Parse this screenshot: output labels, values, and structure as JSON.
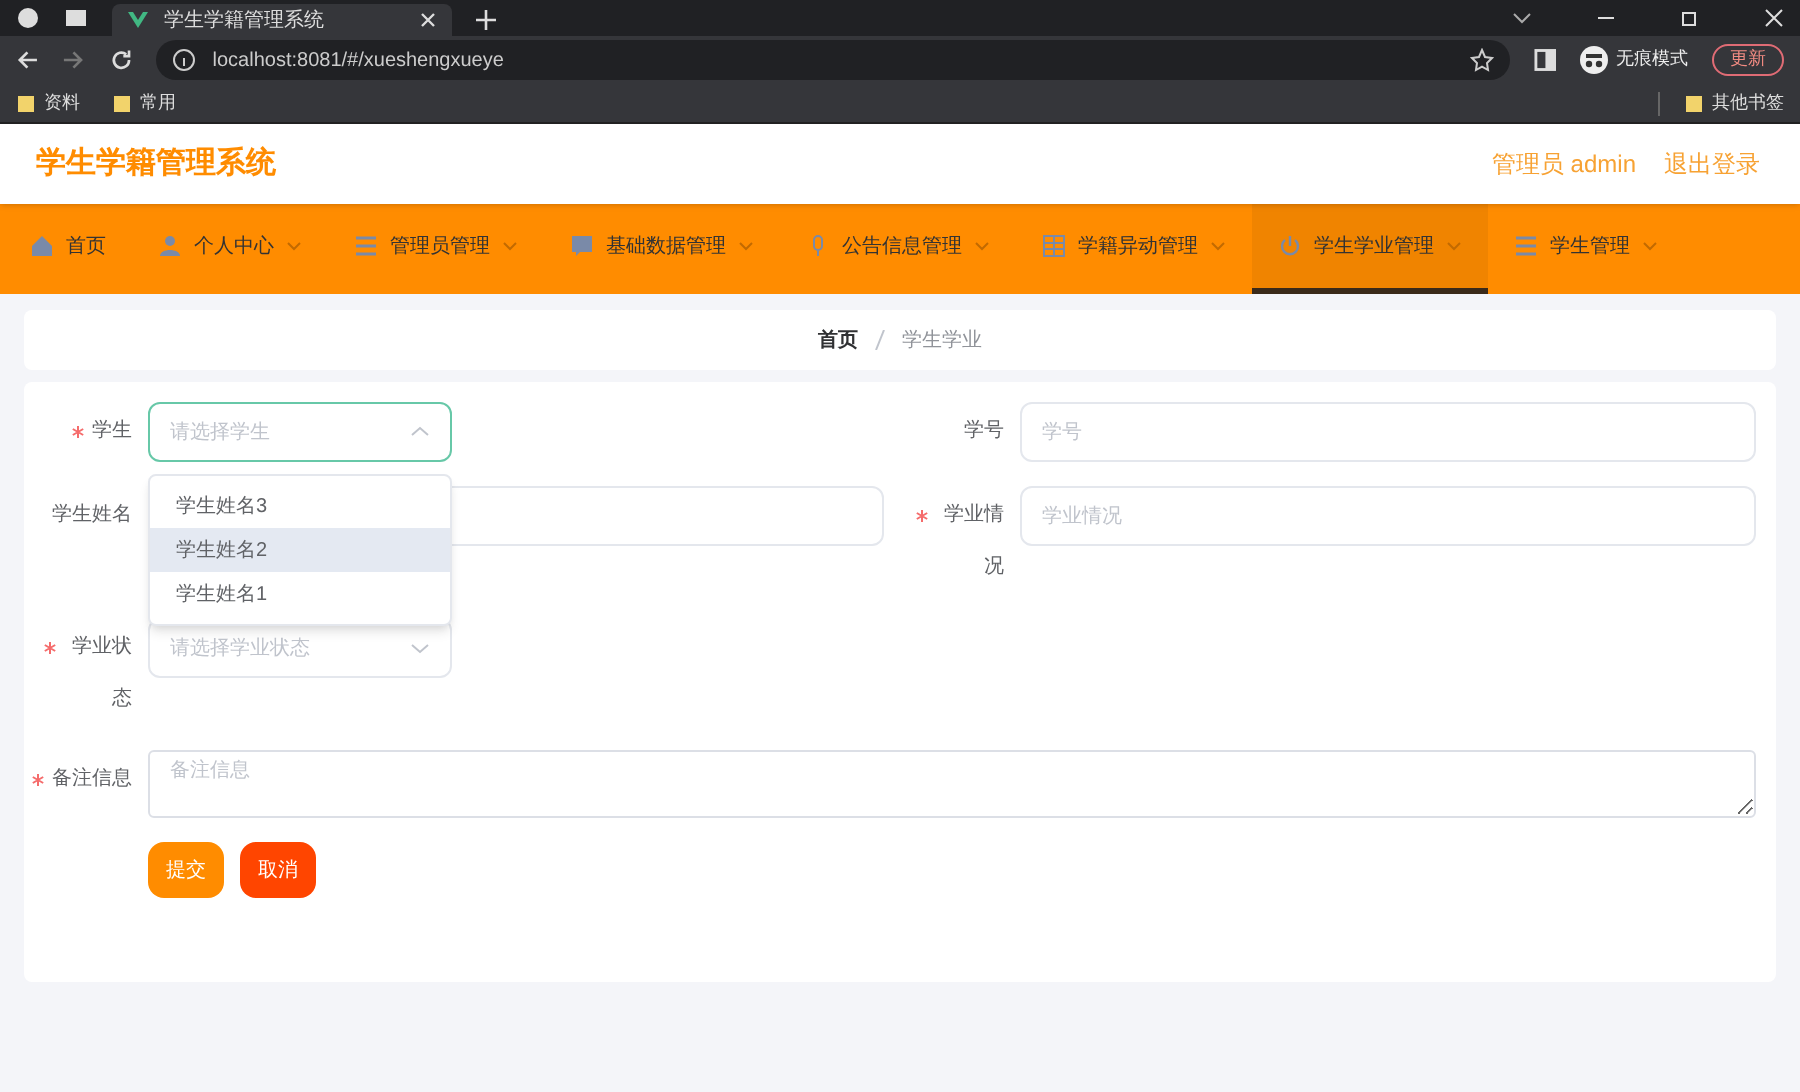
{
  "browser": {
    "tab_title": "学生学籍管理系统",
    "url": "localhost:8081/#/xueshengxueye",
    "bookmarks": [
      {
        "label": "资料"
      },
      {
        "label": "常用"
      }
    ],
    "other_bookmarks": "其他书签",
    "incognito": "无痕模式",
    "update_button": "更新"
  },
  "header": {
    "title": "学生学籍管理系统",
    "user": "管理员 admin",
    "logout": "退出登录"
  },
  "nav": [
    {
      "label": "首页",
      "dropdown": false,
      "selected": false
    },
    {
      "label": "个人中心",
      "dropdown": true,
      "selected": false
    },
    {
      "label": "管理员管理",
      "dropdown": true,
      "selected": false
    },
    {
      "label": "基础数据管理",
      "dropdown": true,
      "selected": false
    },
    {
      "label": "公告信息管理",
      "dropdown": true,
      "selected": false
    },
    {
      "label": "学籍异动管理",
      "dropdown": true,
      "selected": false
    },
    {
      "label": "学生学业管理",
      "dropdown": true,
      "selected": true
    },
    {
      "label": "学生管理",
      "dropdown": true,
      "selected": false
    }
  ],
  "breadcrumb": [
    "首页",
    "学生学业"
  ],
  "form": {
    "rows": [
      [
        {
          "kind": "select",
          "label": "学生",
          "required": true,
          "placeholder": "请选择学生",
          "expanded": true,
          "options": [
            {
              "label": "学生姓名3",
              "hovered": false
            },
            {
              "label": "学生姓名2",
              "hovered": true
            },
            {
              "label": "学生姓名1",
              "hovered": false
            }
          ]
        },
        {
          "kind": "input",
          "label": "学号",
          "required": false,
          "placeholder": "学号"
        }
      ],
      [
        {
          "kind": "input",
          "label": "学生姓名",
          "required": false
        },
        {
          "kind": "input",
          "label": "学业情况",
          "required": true,
          "placeholder": "学业情况"
        }
      ],
      [
        {
          "kind": "select",
          "label": "学业状态",
          "required": true,
          "placeholder": "请选择学业状态",
          "expanded": false
        }
      ],
      [
        {
          "kind": "textarea",
          "label": "备注信息",
          "required": true,
          "placeholder": "备注信息"
        }
      ]
    ],
    "buttons": [
      {
        "label": "提交",
        "kind": "primary"
      },
      {
        "label": "取消",
        "kind": "danger"
      }
    ]
  }
}
